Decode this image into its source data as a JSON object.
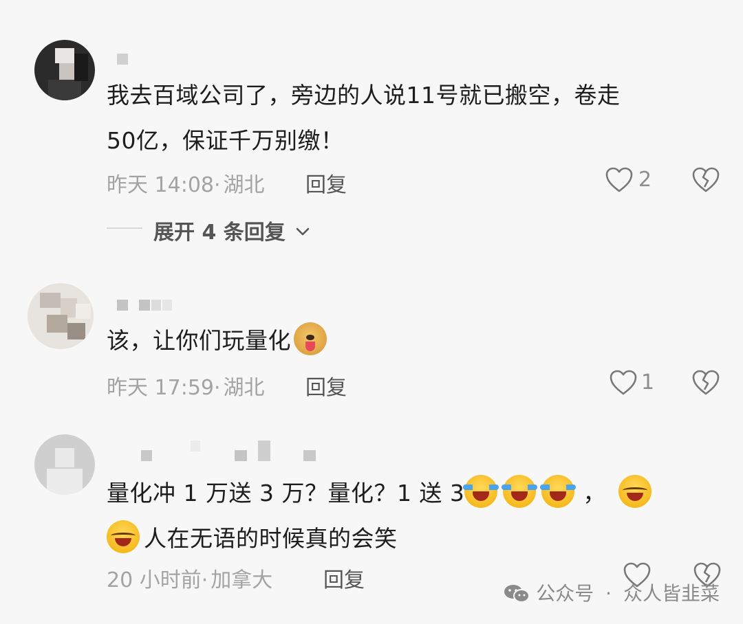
{
  "comments": [
    {
      "text_line1": "我去百域公司了，旁边的人说11号就已搬空，卷走",
      "text_line2": "50亿，保证千万别缴！",
      "time": "昨天 14:08",
      "location": "湖北",
      "reply_label": "回复",
      "likes": "2",
      "expand_label": "展开 4 条回复"
    },
    {
      "text_line1": "该，让你们玩量化",
      "time": "昨天 17:59",
      "location": "湖北",
      "reply_label": "回复",
      "likes": "1"
    },
    {
      "text_line1": "量化冲 1 万送 3 万？量化？1 送 3",
      "text_line1_tail": "，",
      "text_line2": "人在无语的时候真的会笑",
      "time": "20 小时前",
      "location": "加拿大",
      "reply_label": "回复",
      "likes": ""
    }
  ],
  "separator": "·",
  "watermark": {
    "prefix": "公众号",
    "separator": "·",
    "name": "众人皆韭菜"
  },
  "icons": {
    "like": "heart-outline-icon",
    "dislike": "broken-heart-icon",
    "expand": "chevron-down-icon",
    "watermark": "wechat-icon"
  },
  "colors": {
    "background": "#f7f7f7",
    "text": "#1d1d1d",
    "meta": "#a3a3a3",
    "reply": "#555555"
  }
}
